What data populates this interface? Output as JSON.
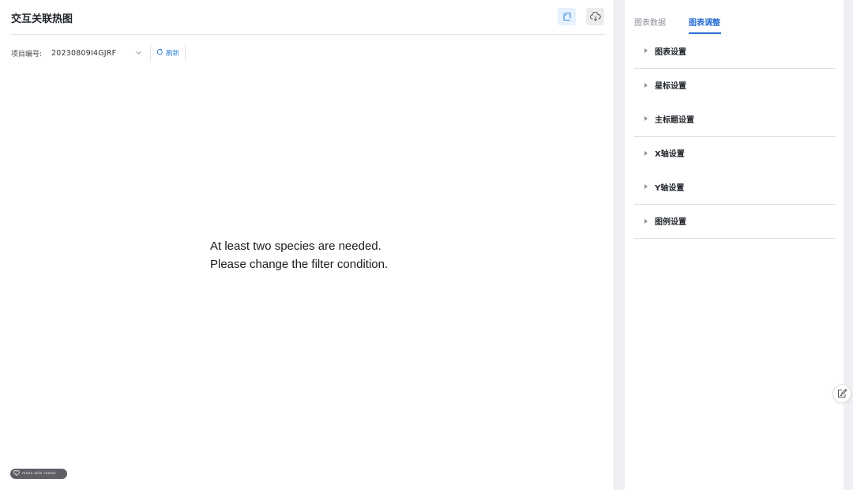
{
  "header": {
    "title": "交互关联热图",
    "chart_button_icon": "chart-icon",
    "download_button_icon": "cloud-download-icon"
  },
  "toolbar": {
    "project_label": "项目编号:",
    "project_value": "20230809I4GJRF",
    "refresh_label": "刷新"
  },
  "main": {
    "message_line1": "At least two species are needed.",
    "message_line2": "Please change the filter condition."
  },
  "badge": {
    "text": "made with seeker"
  },
  "side_panel": {
    "tabs": [
      {
        "label": "图表数据",
        "active": false
      },
      {
        "label": "图表调整",
        "active": true
      }
    ],
    "groups": [
      {
        "items": [
          "图表设置"
        ]
      },
      {
        "items": [
          "星标设置",
          "主标题设置"
        ]
      },
      {
        "items": [
          "X轴设置",
          "Y轴设置"
        ]
      },
      {
        "items": [
          "图例设置"
        ]
      }
    ]
  },
  "colors": {
    "accent": "#2b6fd3",
    "badge_bg": "#5f6065",
    "page_bg": "#eef0f3"
  }
}
